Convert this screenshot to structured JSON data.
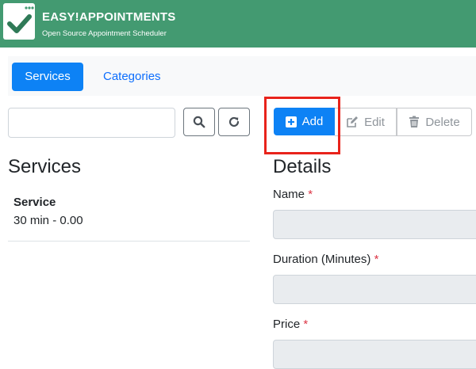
{
  "app": {
    "title": "EASY!APPOINTMENTS",
    "subtitle": "Open Source Appointment Scheduler"
  },
  "tabs": [
    {
      "label": "Services",
      "active": true
    },
    {
      "label": "Categories",
      "active": false
    }
  ],
  "search": {
    "value": "",
    "placeholder": ""
  },
  "toolbar": {
    "add_label": "Add",
    "edit_label": "Edit",
    "delete_label": "Delete"
  },
  "list": {
    "heading": "Services",
    "items": [
      {
        "name": "Service",
        "meta": "30 min - 0.00"
      }
    ]
  },
  "details": {
    "heading": "Details",
    "fields": [
      {
        "label": "Name",
        "required_mark": "*",
        "value": ""
      },
      {
        "label": "Duration (Minutes)",
        "required_mark": "*",
        "value": ""
      },
      {
        "label": "Price",
        "required_mark": "*",
        "value": ""
      }
    ]
  },
  "colors": {
    "brand": "#439a71",
    "primary": "#0d82f5",
    "highlight": "#e8231b"
  },
  "icons": [
    "logo-check-icon",
    "search-icon",
    "refresh-icon",
    "plus-square-icon",
    "edit-icon",
    "trash-icon"
  ]
}
